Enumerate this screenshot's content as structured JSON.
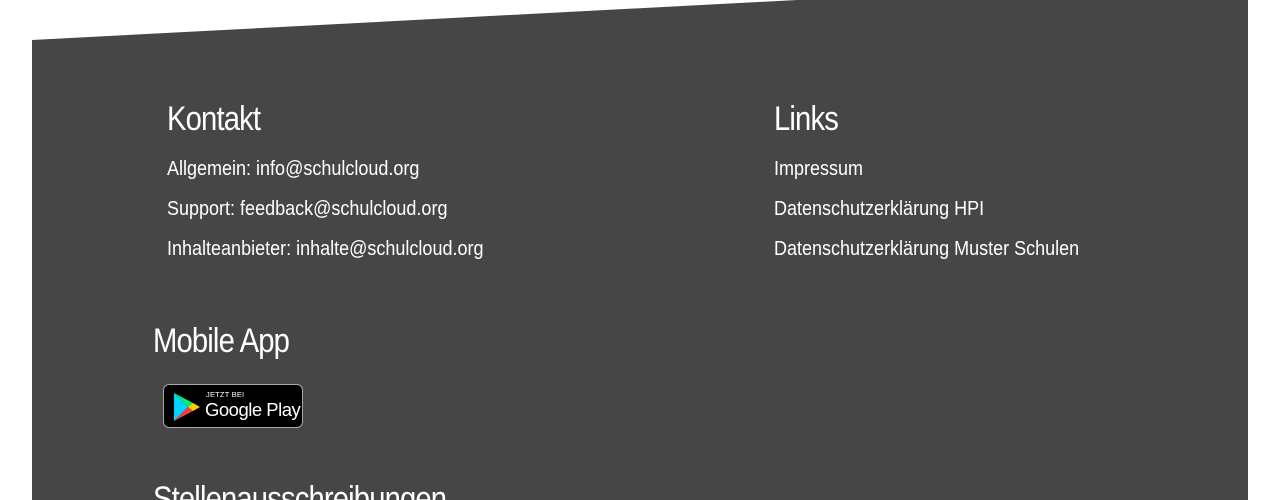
{
  "footer": {
    "contact": {
      "title": "Kontakt",
      "items": [
        {
          "label": "Allgemein: ",
          "value": "info@schulcloud.org"
        },
        {
          "label": "Support: ",
          "value": "feedback@schulcloud.org"
        },
        {
          "label": "Inhalteanbieter: ",
          "value": "inhalte@schulcloud.org"
        }
      ]
    },
    "links": {
      "title": "Links",
      "items": [
        {
          "label": "Impressum"
        },
        {
          "label": "Datenschutzerklärung HPI"
        },
        {
          "label": "Datenschutzerklärung Muster Schulen"
        }
      ]
    },
    "mobile_app": {
      "title": "Mobile App",
      "badge": {
        "small_text": "JETZT BEI",
        "big_text": "Google Play",
        "icon": "google-play-icon"
      }
    },
    "jobs": {
      "title": "Stellenausschreibungen"
    }
  },
  "colors": {
    "footer_background": "#464646",
    "text": "#ffffff",
    "page_background": "#ffffff",
    "badge_background": "#000000",
    "badge_border": "#a6a6a6"
  }
}
